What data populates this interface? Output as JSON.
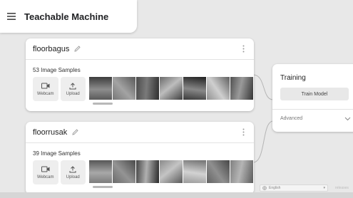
{
  "app": {
    "title": "Teachable Machine"
  },
  "classes": [
    {
      "name": "floorbagus",
      "samples_label": "53 Image Samples",
      "webcam_label": "Webcam",
      "upload_label": "Upload",
      "thumbnails": [
        {
          "palette": [
            "#5a5a5a",
            "#8d8d8d",
            "#3c3c3c"
          ]
        },
        {
          "palette": [
            "#777777",
            "#a3a3a3",
            "#595959"
          ]
        },
        {
          "palette": [
            "#4c4c4c",
            "#7a7a7a",
            "#2f2f2f"
          ]
        },
        {
          "palette": [
            "#6a6a6a",
            "#bdbdbd",
            "#404040"
          ]
        },
        {
          "palette": [
            "#3a3a3a",
            "#888888",
            "#1f1f1f"
          ]
        },
        {
          "palette": [
            "#919191",
            "#cfcfcf",
            "#5f5f5f"
          ]
        },
        {
          "palette": [
            "#505050",
            "#9a9a9a",
            "#353535"
          ]
        }
      ]
    },
    {
      "name": "floorrusak",
      "samples_label": "39 Image Samples",
      "webcam_label": "Webcam",
      "upload_label": "Upload",
      "thumbnails": [
        {
          "palette": [
            "#7c7c7c",
            "#a8a8a8",
            "#565656"
          ]
        },
        {
          "palette": [
            "#6b6b6b",
            "#949494",
            "#4a4a4a"
          ]
        },
        {
          "palette": [
            "#454545",
            "#b0b0b0",
            "#2a2a2a"
          ]
        },
        {
          "palette": [
            "#8a8a8a",
            "#c4c4c4",
            "#5a5a5a"
          ]
        },
        {
          "palette": [
            "#9b9b9b",
            "#d2d2d2",
            "#707070"
          ]
        },
        {
          "palette": [
            "#636363",
            "#8f8f8f",
            "#474747"
          ]
        },
        {
          "palette": [
            "#808080",
            "#b5b5b5",
            "#5c5c5c"
          ]
        }
      ]
    }
  ],
  "training": {
    "title": "Training",
    "train_button": "Train Model",
    "advanced_label": "Advanced"
  },
  "footer": {
    "language": "English",
    "link": "releases"
  },
  "colors": {
    "background": "#e8e8e8",
    "card": "#ffffff",
    "button": "#e8e8e8"
  },
  "icons": [
    "menu-icon",
    "pencil-icon",
    "kebab-icon",
    "webcam-icon",
    "upload-icon",
    "chevron-down-icon",
    "globe-icon"
  ]
}
